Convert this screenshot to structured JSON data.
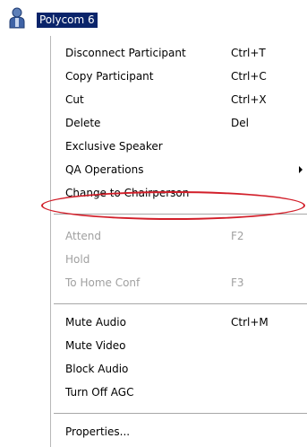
{
  "tree_node": {
    "icon": "user-icon",
    "label": "Polycom 6"
  },
  "context_menu": {
    "items": [
      {
        "label": "Disconnect Participant",
        "shortcut": "Ctrl+T",
        "enabled": true
      },
      {
        "label": "Copy Participant",
        "shortcut": "Ctrl+C",
        "enabled": true
      },
      {
        "label": "Cut",
        "shortcut": "Ctrl+X",
        "enabled": true
      },
      {
        "label": "Delete",
        "shortcut": "Del",
        "enabled": true
      },
      {
        "label": "Exclusive Speaker",
        "shortcut": "",
        "enabled": true
      },
      {
        "label": "QA Operations",
        "shortcut": "",
        "enabled": true,
        "has_submenu": true
      },
      {
        "label": "Change to Chairperson",
        "shortcut": "",
        "enabled": true,
        "highlighted_by_annotation": true
      },
      {
        "label": "Attend",
        "shortcut": "F2",
        "enabled": false
      },
      {
        "label": "Hold",
        "shortcut": "",
        "enabled": false
      },
      {
        "label": "To Home Conf",
        "shortcut": "F3",
        "enabled": false
      },
      {
        "label": "Mute Audio",
        "shortcut": "Ctrl+M",
        "enabled": true
      },
      {
        "label": "Mute Video",
        "shortcut": "",
        "enabled": true
      },
      {
        "label": "Block Audio",
        "shortcut": "",
        "enabled": true
      },
      {
        "label": "Turn Off AGC",
        "shortcut": "",
        "enabled": true
      },
      {
        "label": "Properties...",
        "shortcut": "",
        "enabled": true
      }
    ]
  },
  "colors": {
    "selection": "#0a246a",
    "annotation": "#d21f2a",
    "disabled_text": "#a0a0a0"
  }
}
